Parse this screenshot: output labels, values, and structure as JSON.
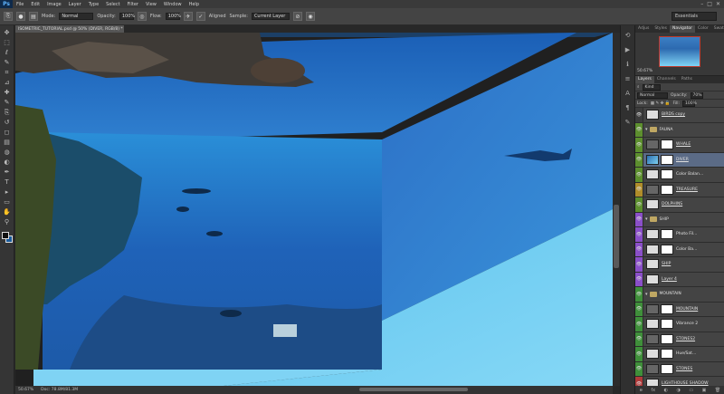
{
  "app": {
    "logo": "Ps"
  },
  "menu": [
    "File",
    "Edit",
    "Image",
    "Layer",
    "Type",
    "Select",
    "Filter",
    "View",
    "Window",
    "Help"
  ],
  "window_controls": [
    "–",
    "□",
    "✕"
  ],
  "options_bar": {
    "mode_label": "Mode:",
    "mode_value": "Normal",
    "opacity_label": "Opacity:",
    "opacity_value": "100%",
    "flow_label": "Flow:",
    "flow_value": "100%",
    "aligned_label": "Aligned",
    "sample_label": "Sample:",
    "sample_value": "Current Layer",
    "workspace": "Essentials"
  },
  "document": {
    "tab_title": "ISOMETRIC_TUTORIAL.psd @ 50% (DIVER, RGB/8) *",
    "zoom": "50.67%",
    "doc_size": "Doc: 78.8M/81.3M"
  },
  "panels": {
    "top_tabs": [
      "Adjus",
      "Styles",
      "Navigator",
      "Color",
      "Swatc"
    ],
    "top_active": "Navigator",
    "nav_zoom": "50.67%",
    "layer_tabs": [
      "Layers",
      "Channels",
      "Paths"
    ],
    "layer_active": "Layers",
    "kind_label": "Kind",
    "blend_mode": "Normal",
    "opacity_label": "Opacity:",
    "opacity_value": "70%",
    "lock_label": "Lock:",
    "fill_label": "Fill:",
    "fill_value": "100%"
  },
  "layers": [
    {
      "name": "BIRDS copy",
      "color": "#3c3c3c",
      "kind": "layer",
      "thumb": "light",
      "selected": false
    },
    {
      "name": "FAUNA",
      "color": "#5d8f2e",
      "kind": "group",
      "thumb": "",
      "selected": false
    },
    {
      "name": "WHALE",
      "color": "#5d8f2e",
      "kind": "layer",
      "thumb": "dark",
      "selected": false
    },
    {
      "name": "DIVER",
      "color": "#5d8f2e",
      "kind": "layer",
      "thumb": "img",
      "selected": true
    },
    {
      "name": "Color Balan...",
      "color": "#5d8f2e",
      "kind": "adjust",
      "thumb": "light",
      "selected": false
    },
    {
      "name": "TREASURE",
      "color": "#b08d2a",
      "kind": "layer",
      "thumb": "dark",
      "selected": false
    },
    {
      "name": "DOLPHINS",
      "color": "#5d8f2e",
      "kind": "layer",
      "thumb": "light",
      "selected": false
    },
    {
      "name": "SHIP",
      "color": "#8a4fc8",
      "kind": "group",
      "thumb": "",
      "selected": false
    },
    {
      "name": "Photo Fil...",
      "color": "#8a4fc8",
      "kind": "adjust",
      "thumb": "light",
      "selected": false
    },
    {
      "name": "Color Ba...",
      "color": "#8a4fc8",
      "kind": "adjust",
      "thumb": "light",
      "selected": false
    },
    {
      "name": "SHIP",
      "color": "#8a4fc8",
      "kind": "layer",
      "thumb": "light",
      "selected": false
    },
    {
      "name": "Layer 4",
      "color": "#8a4fc8",
      "kind": "layer",
      "thumb": "light",
      "selected": false
    },
    {
      "name": "MOUNTAIN",
      "color": "#3f8f3a",
      "kind": "group",
      "thumb": "",
      "selected": false
    },
    {
      "name": "MOUNTAIN",
      "color": "#3f8f3a",
      "kind": "layer",
      "thumb": "dark",
      "selected": false
    },
    {
      "name": "Vibrance 2",
      "color": "#3f8f3a",
      "kind": "adjust",
      "thumb": "light",
      "selected": false
    },
    {
      "name": "STONES2",
      "color": "#3f8f3a",
      "kind": "layer",
      "thumb": "dark",
      "selected": false
    },
    {
      "name": "Hue/Sat...",
      "color": "#3f8f3a",
      "kind": "adjust",
      "thumb": "light",
      "selected": false
    },
    {
      "name": "STONES",
      "color": "#3f8f3a",
      "kind": "layer",
      "thumb": "dark",
      "selected": false
    },
    {
      "name": "LIGHTHOUSE SHADOW",
      "color": "#b03a3a",
      "kind": "layer",
      "thumb": "light",
      "selected": false
    }
  ],
  "layer_footer": [
    "ɵ",
    "fx",
    "◐",
    "◑",
    "▭",
    "▣",
    "🗑"
  ],
  "icons": {
    "tools": [
      "move-icon",
      "marquee-icon",
      "lasso-icon",
      "quick-select-icon",
      "crop-icon",
      "eyedropper-icon",
      "healing-icon",
      "brush-icon",
      "clone-stamp-icon",
      "history-brush-icon",
      "eraser-icon",
      "gradient-icon",
      "blur-icon",
      "dodge-icon",
      "pen-icon",
      "type-icon",
      "path-select-icon",
      "shape-icon",
      "hand-icon",
      "zoom-icon"
    ]
  }
}
